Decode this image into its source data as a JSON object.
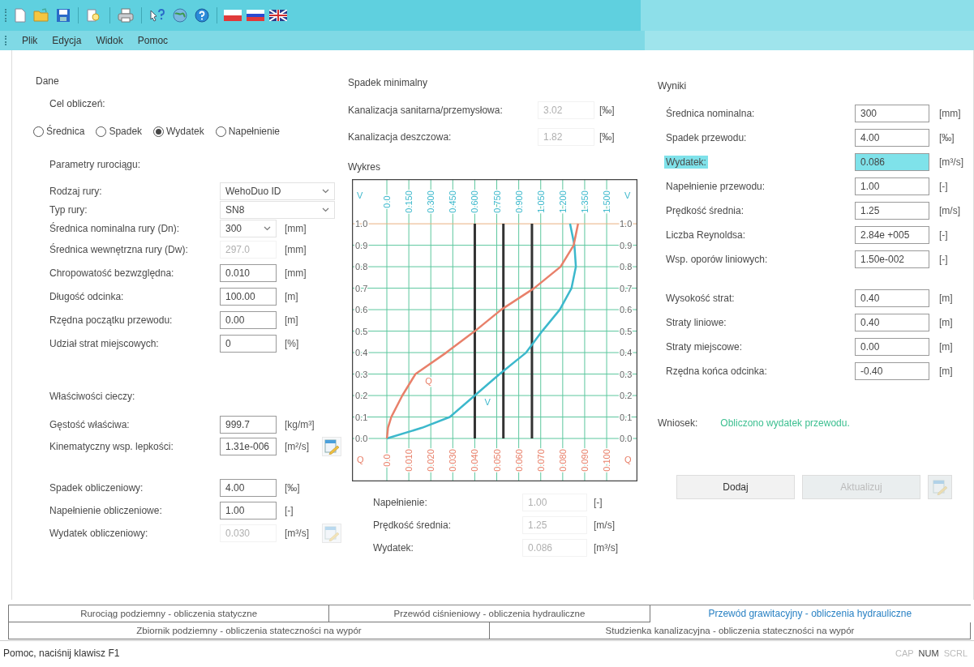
{
  "menu": [
    {
      "label": "Plik"
    },
    {
      "label": "Edycja"
    },
    {
      "label": "Widok"
    },
    {
      "label": "Pomoc"
    }
  ],
  "input_panel": {
    "title": "Dane",
    "goal_label": "Cel obliczeń:",
    "goal_options": [
      {
        "label": "Średnica",
        "selected": false
      },
      {
        "label": "Spadek",
        "selected": false
      },
      {
        "label": "Wydatek",
        "selected": true
      },
      {
        "label": "Napełnienie",
        "selected": false
      }
    ],
    "groups": [
      {
        "title": "Parametry rurociągu:",
        "rows": [
          {
            "label": "Rodzaj rury:",
            "kind": "select",
            "value": "WehoDuo ID"
          },
          {
            "label": "Typ rury:",
            "kind": "select",
            "value": "SN8"
          },
          {
            "label": "Średnica nominalna rury (Dn):",
            "kind": "select",
            "value": "300",
            "unit": "[mm]"
          },
          {
            "label": "Średnica wewnętrzna rury (Dw):",
            "kind": "readonly",
            "value": "297.0",
            "unit": "[mm]"
          },
          {
            "label": "Chropowatość bezwzględna:",
            "kind": "input",
            "value": "0.010",
            "unit": "[mm]"
          },
          {
            "label": "Długość odcinka:",
            "kind": "input",
            "value": "100.00",
            "unit": "[m]"
          },
          {
            "label": "Rzędna początku przewodu:",
            "kind": "input",
            "value": "0.00",
            "unit": "[m]"
          },
          {
            "label": "Udział strat miejscowych:",
            "kind": "input",
            "value": "0",
            "unit": "[%]"
          }
        ]
      },
      {
        "title": "Właściwości cieczy:",
        "rows": [
          {
            "label": "Gęstość właściwa:",
            "kind": "input",
            "value": "999.7",
            "unit": "[kg/m³]"
          },
          {
            "label": "Kinematyczny wsp. lepkości:",
            "kind": "input",
            "value": "1.31e-006",
            "unit": "[m²/s]",
            "button": {
              "disabled": false
            }
          }
        ]
      },
      {
        "rows": [
          {
            "label": "Spadek obliczeniowy:",
            "kind": "input",
            "value": "4.00",
            "unit": "[‰]"
          },
          {
            "label": "Napełnienie obliczeniowe:",
            "kind": "input",
            "value": "1.00",
            "unit": "[-]"
          },
          {
            "label": "Wydatek obliczeniowy:",
            "kind": "readonly",
            "value": "0.030",
            "unit": "[m³/s]",
            "button": {
              "disabled": true
            }
          }
        ]
      }
    ]
  },
  "min_slope_panel": {
    "title": "Spadek minimalny",
    "rows": [
      {
        "label": "Kanalizacja sanitarna/przemysłowa:",
        "kind": "readonly",
        "value": "3.02",
        "unit": "[‰]"
      },
      {
        "label": "Kanalizacja deszczowa:",
        "kind": "readonly",
        "value": "1.82",
        "unit": "[‰]"
      }
    ]
  },
  "chart_panel": {
    "title": "Wykres",
    "chart_data": {
      "type": "line",
      "xlabel": "V",
      "x2label": "Q",
      "grid": true,
      "xlim": [
        -0.238,
        1.71
      ],
      "x2lim": [
        -0.0159,
        0.114
      ],
      "ylim": [
        -0.2,
        1.208
      ],
      "series": [
        {
          "name": "V",
          "color": "#3cb8cc",
          "x": [
            0,
            0.24,
            0.43,
            0.6,
            0.77,
            0.95,
            1.06,
            1.18,
            1.26,
            1.29,
            1.28,
            1.25
          ],
          "values": [
            0,
            0.05,
            0.1,
            0.2,
            0.3,
            0.4,
            0.5,
            0.6,
            0.7,
            0.8,
            0.9,
            1.0
          ]
        },
        {
          "name": "Q",
          "color": "#e8806a",
          "axis": "x2",
          "x": [
            0,
            0.0005,
            0.002,
            0.007,
            0.013,
            0.027,
            0.04,
            0.052,
            0.067,
            0.079,
            0.085,
            0.087
          ],
          "values": [
            0,
            0.05,
            0.1,
            0.2,
            0.3,
            0.4,
            0.5,
            0.6,
            0.7,
            0.8,
            0.9,
            1.0
          ]
        }
      ],
      "xticks": [
        {
          "value": 0,
          "label": "0.0"
        },
        {
          "value": 0.15,
          "label": "0.150"
        },
        {
          "value": 0.3,
          "label": "0.300"
        },
        {
          "value": 0.45,
          "label": "0.450"
        },
        {
          "value": 0.6,
          "label": "0.600"
        },
        {
          "value": 0.75,
          "label": "0.750"
        },
        {
          "value": 0.9,
          "label": "0.900"
        },
        {
          "value": 1.05,
          "label": "1.050"
        },
        {
          "value": 1.2,
          "label": "1.200"
        },
        {
          "value": 1.35,
          "label": "1.350"
        },
        {
          "value": 1.5,
          "label": "1.500"
        }
      ],
      "x2ticks": [
        {
          "value": 0,
          "label": "0.0"
        },
        {
          "value": 0.01,
          "label": "0.010"
        },
        {
          "value": 0.02,
          "label": "0.020"
        },
        {
          "value": 0.03,
          "label": "0.030"
        },
        {
          "value": 0.04,
          "label": "0.040"
        },
        {
          "value": 0.05,
          "label": "0.050"
        },
        {
          "value": 0.06,
          "label": "0.060"
        },
        {
          "value": 0.07,
          "label": "0.070"
        },
        {
          "value": 0.08,
          "label": "0.080"
        },
        {
          "value": 0.09,
          "label": "0.090"
        },
        {
          "value": 0.1,
          "label": "0.100"
        }
      ],
      "yticks": [
        {
          "value": 0,
          "label": "0.0"
        },
        {
          "value": 0.1,
          "label": "0.1"
        },
        {
          "value": 0.2,
          "label": "0.2"
        },
        {
          "value": 0.3,
          "label": "0.3"
        },
        {
          "value": 0.4,
          "label": "0.4"
        },
        {
          "value": 0.5,
          "label": "0.5"
        },
        {
          "value": 0.6,
          "label": "0.6"
        },
        {
          "value": 0.7,
          "label": "0.7"
        },
        {
          "value": 0.8,
          "label": "0.8"
        },
        {
          "value": 0.9,
          "label": "0.9"
        },
        {
          "value": 1,
          "label": "1.0"
        }
      ],
      "ref_lines": [
        {
          "axis": "x2",
          "value": 0.04
        },
        {
          "axis": "x2",
          "value": 0.053
        },
        {
          "axis": "x2",
          "value": 0.066
        }
      ]
    },
    "rows": [
      {
        "label": "Napełnienie:",
        "kind": "readonly",
        "value": "1.00",
        "unit": "[-]"
      },
      {
        "label": "Prędkość średnia:",
        "kind": "readonly",
        "value": "1.25",
        "unit": "[m/s]"
      },
      {
        "label": "Wydatek:",
        "kind": "readonly",
        "value": "0.086",
        "unit": "[m³/s]"
      }
    ]
  },
  "results_panel": {
    "title": "Wyniki",
    "groups": [
      {
        "rows": [
          {
            "label": "Średnica nominalna:",
            "kind": "input",
            "value": "300",
            "unit": "[mm]",
            "highlighted": false
          },
          {
            "label": "Spadek przewodu:",
            "kind": "input",
            "value": "4.00",
            "unit": "[‰]",
            "highlighted": false
          },
          {
            "label": "Wydatek:",
            "kind": "input",
            "value": "0.086",
            "unit": "[m³/s]",
            "highlighted": true
          },
          {
            "label": "Napełnienie przewodu:",
            "kind": "input",
            "value": "1.00",
            "unit": "[-]",
            "highlighted": false
          },
          {
            "label": "Prędkość średnia:",
            "kind": "input",
            "value": "1.25",
            "unit": "[m/s]",
            "highlighted": false
          },
          {
            "label": "Liczba Reynoldsa:",
            "kind": "input",
            "value": "2.84e +005",
            "unit": "[-]",
            "highlighted": false
          },
          {
            "label": "Wsp. oporów liniowych:",
            "kind": "input",
            "value": "1.50e-002",
            "unit": "[-]",
            "highlighted": false
          }
        ]
      },
      {
        "rows": [
          {
            "label": "Wysokość strat:",
            "kind": "input",
            "value": "0.40",
            "unit": "[m]",
            "highlighted": false
          },
          {
            "label": "Straty liniowe:",
            "kind": "input",
            "value": "0.40",
            "unit": "[m]",
            "highlighted": false
          },
          {
            "label": "Straty miejscowe:",
            "kind": "input",
            "value": "0.00",
            "unit": "[m]",
            "highlighted": false
          },
          {
            "label": "Rzędna końca odcinka:",
            "kind": "input",
            "value": "-0.40",
            "unit": "[m]",
            "highlighted": false
          }
        ]
      }
    ],
    "conclusion_label": "Wniosek:",
    "conclusion": "Obliczono wydatek przewodu.",
    "buttons": [
      {
        "kind": "text",
        "label": "Dodaj",
        "disabled": false
      },
      {
        "kind": "text",
        "label": "Aktualizuj",
        "disabled": true
      },
      {
        "kind": "icon",
        "disabled": true
      }
    ]
  },
  "tab_rows": [
    {
      "tabs": [
        {
          "label": "Rurociąg podziemny - obliczenia statyczne",
          "selected": false
        },
        {
          "label": "Przewód ciśnieniowy - obliczenia hydrauliczne",
          "selected": false
        },
        {
          "label": "Przewód grawitacyjny - obliczenia hydrauliczne",
          "selected": true
        }
      ]
    },
    {
      "tabs": [
        {
          "label": "Zbiornik podziemny - obliczenia stateczności na wypór",
          "selected": false
        },
        {
          "label": "Studzienka kanalizacyjna - obliczenia stateczności na wypór",
          "selected": false
        }
      ]
    }
  ],
  "status_bar": {
    "text": "Pomoc, naciśnij klawisz F1",
    "indicators": [
      {
        "label": "CAP",
        "on": false
      },
      {
        "label": "NUM",
        "on": true
      },
      {
        "label": "SCRL",
        "on": false
      }
    ]
  }
}
